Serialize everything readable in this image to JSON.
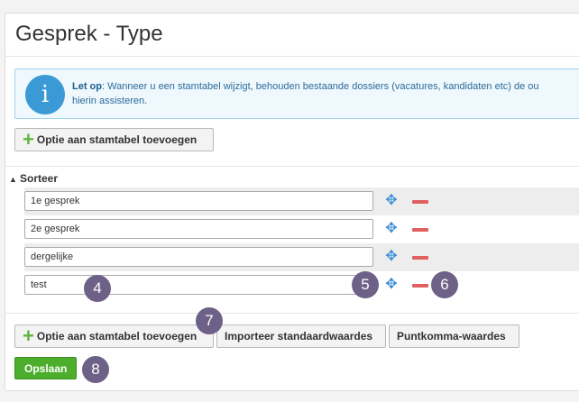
{
  "page": {
    "title": "Gesprek - Type"
  },
  "info": {
    "icon": "i",
    "lead": "Let op",
    "text": ": Wanneer u een stamtabel wijzigt, behouden bestaande dossiers (vacatures, kandidaten etc) de ou",
    "text2": "hierin assisteren."
  },
  "buttons": {
    "add_option_top": "Optie aan stamtabel toevoegen",
    "add_option_bottom": "Optie aan stamtabel toevoegen",
    "import_defaults": "Importeer standaardwaardes",
    "semicolon_values": "Puntkomma-waardes",
    "save": "Opslaan"
  },
  "sort": {
    "header": "Sorteer"
  },
  "rows": [
    {
      "value": "1e gesprek"
    },
    {
      "value": "2e gesprek"
    },
    {
      "value": "dergelijke"
    },
    {
      "value": "test"
    }
  ],
  "badges": [
    "4",
    "5",
    "6",
    "7",
    "8"
  ],
  "icons": {
    "info": "info-icon",
    "move": "move-arrows-icon",
    "remove": "minus-icon",
    "add": "plus-icon",
    "sort": "sort-icon"
  },
  "colors": {
    "accent_green": "#4cae2c",
    "info_blue": "#3b9ad6",
    "remove_red": "#e06060",
    "badge": "#6e6188"
  }
}
